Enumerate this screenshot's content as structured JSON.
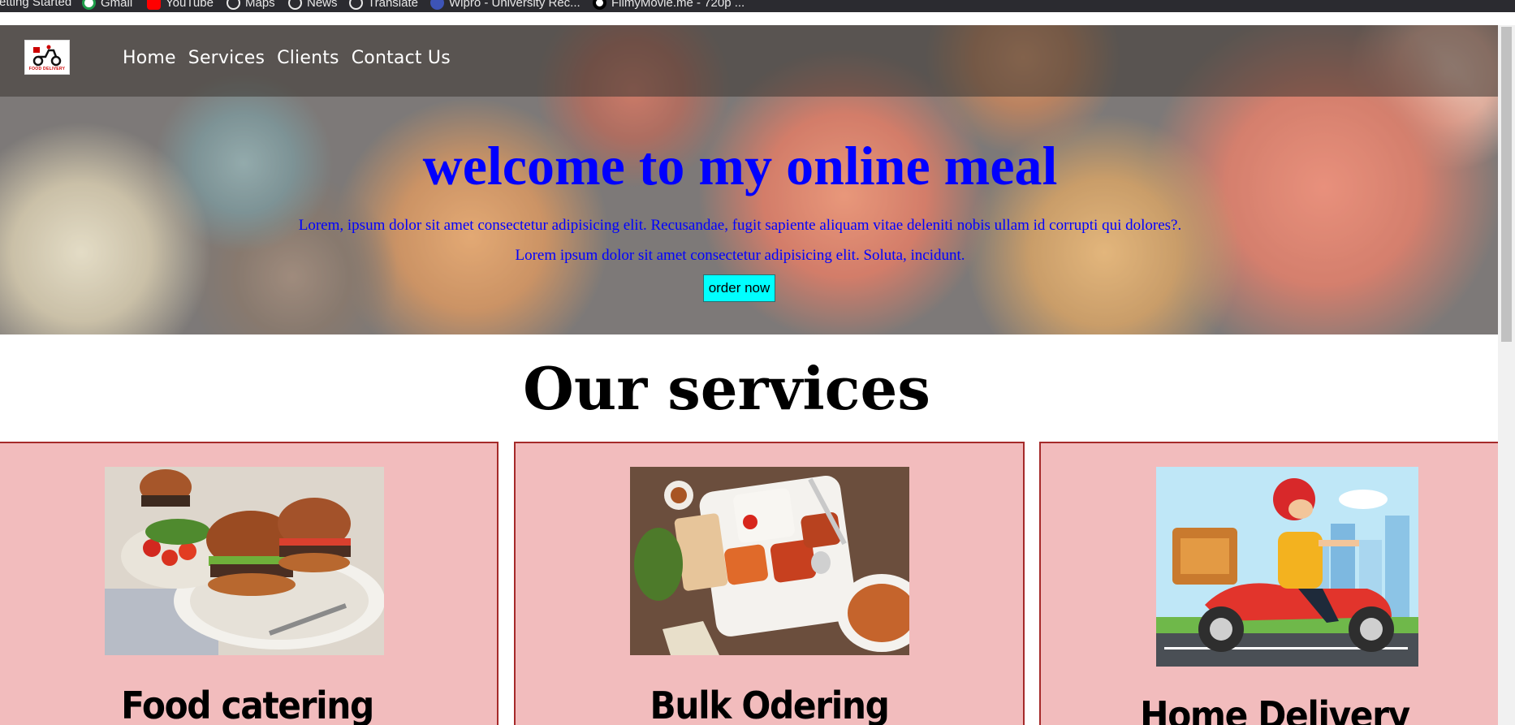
{
  "browser": {
    "bookmarks": [
      {
        "label": "etting Started",
        "icon": "bookmark-icon"
      },
      {
        "label": "Gmail",
        "icon": "gmail-icon"
      },
      {
        "label": "YouTube",
        "icon": "youtube-icon"
      },
      {
        "label": "Maps",
        "icon": "globe-icon"
      },
      {
        "label": "News",
        "icon": "globe-icon"
      },
      {
        "label": "Translate",
        "icon": "globe-icon"
      },
      {
        "label": "Wipro - University Rec...",
        "icon": "wipro-icon"
      },
      {
        "label": "FilmyMovie.me - 720p ...",
        "icon": "filmy-icon"
      }
    ]
  },
  "header": {
    "logo_text": "FOOD DELIVERY",
    "nav": [
      {
        "label": "Home"
      },
      {
        "label": "Services"
      },
      {
        "label": "Clients"
      },
      {
        "label": "Contact Us"
      }
    ]
  },
  "hero": {
    "title": "welcome to my online meal",
    "line1": "Lorem, ipsum dolor sit amet consectetur adipisicing elit. Recusandae, fugit sapiente aliquam vitae deleniti nobis ullam id corrupti qui dolores?.",
    "line2": "Lorem ipsum dolor sit amet consectetur adipisicing elit. Soluta, incidunt.",
    "button_label": "order now"
  },
  "services": {
    "title": "Our services",
    "cards": [
      {
        "title": "Food catering",
        "image": "burger-plate-image"
      },
      {
        "title": "Bulk Odering",
        "image": "thali-meal-image"
      },
      {
        "title": "Home Delivery",
        "image": "scooter-delivery-image"
      }
    ]
  },
  "colors": {
    "hero_text": "#0000ff",
    "button_bg": "#00ffff",
    "card_bg": "#f2bcbd",
    "card_border": "#a52a2a"
  }
}
